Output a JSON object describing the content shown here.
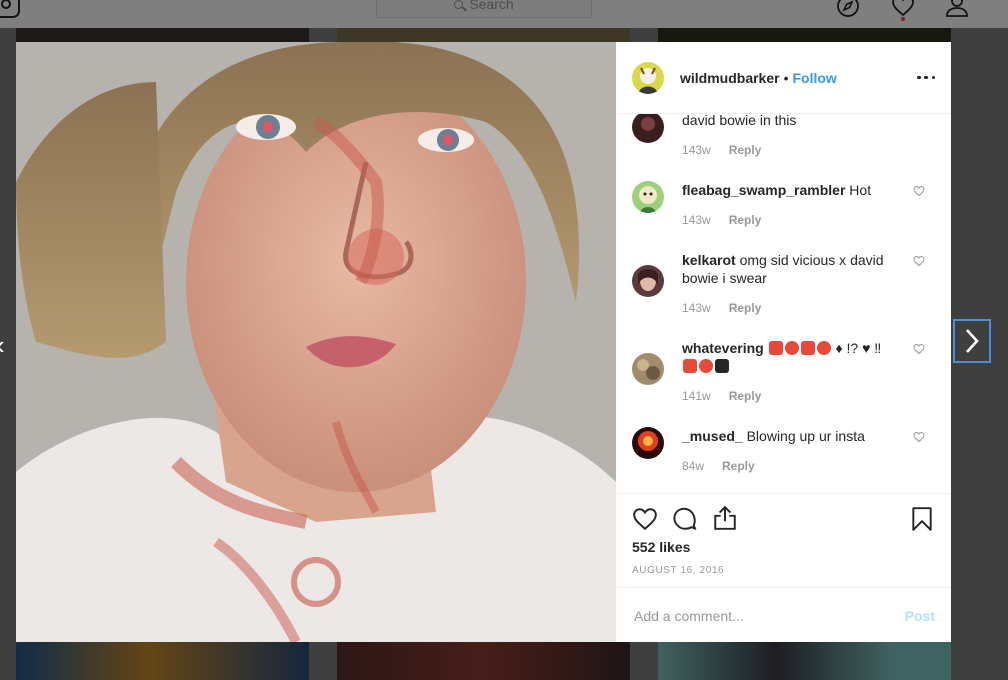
{
  "nav": {
    "search_placeholder": "Search"
  },
  "post": {
    "username": "wildmudbarker",
    "separator": "•",
    "follow_label": "Follow",
    "likes": "552 likes",
    "date": "AUGUST 16, 2016",
    "add_comment_placeholder": "Add a comment...",
    "post_label": "Post"
  },
  "comments": [
    {
      "user": "",
      "text": "david bowie in this",
      "age": "143w",
      "reply": "Reply"
    },
    {
      "user": "fleabag_swamp_rambler",
      "text": "Hot",
      "age": "143w",
      "reply": "Reply"
    },
    {
      "user": "kelkarot",
      "text": "omg sid vicious x david bowie i swear",
      "age": "143w",
      "reply": "Reply"
    },
    {
      "user": "whatevering",
      "text": "♦  !?  ♥  ‼",
      "age": "141w",
      "reply": "Reply"
    },
    {
      "user": "_mused_",
      "text": "Blowing up ur insta",
      "age": "84w",
      "reply": "Reply"
    }
  ],
  "icons": {
    "like": "heart-outline-icon",
    "comment": "speech-bubble-icon",
    "share": "share-icon",
    "save": "bookmark-icon",
    "more": "more-dots-icon"
  },
  "colors": {
    "link": "#3897f0",
    "muted": "#999999",
    "post_disabled": "#b2dffc",
    "focus": "#4a90d9"
  }
}
